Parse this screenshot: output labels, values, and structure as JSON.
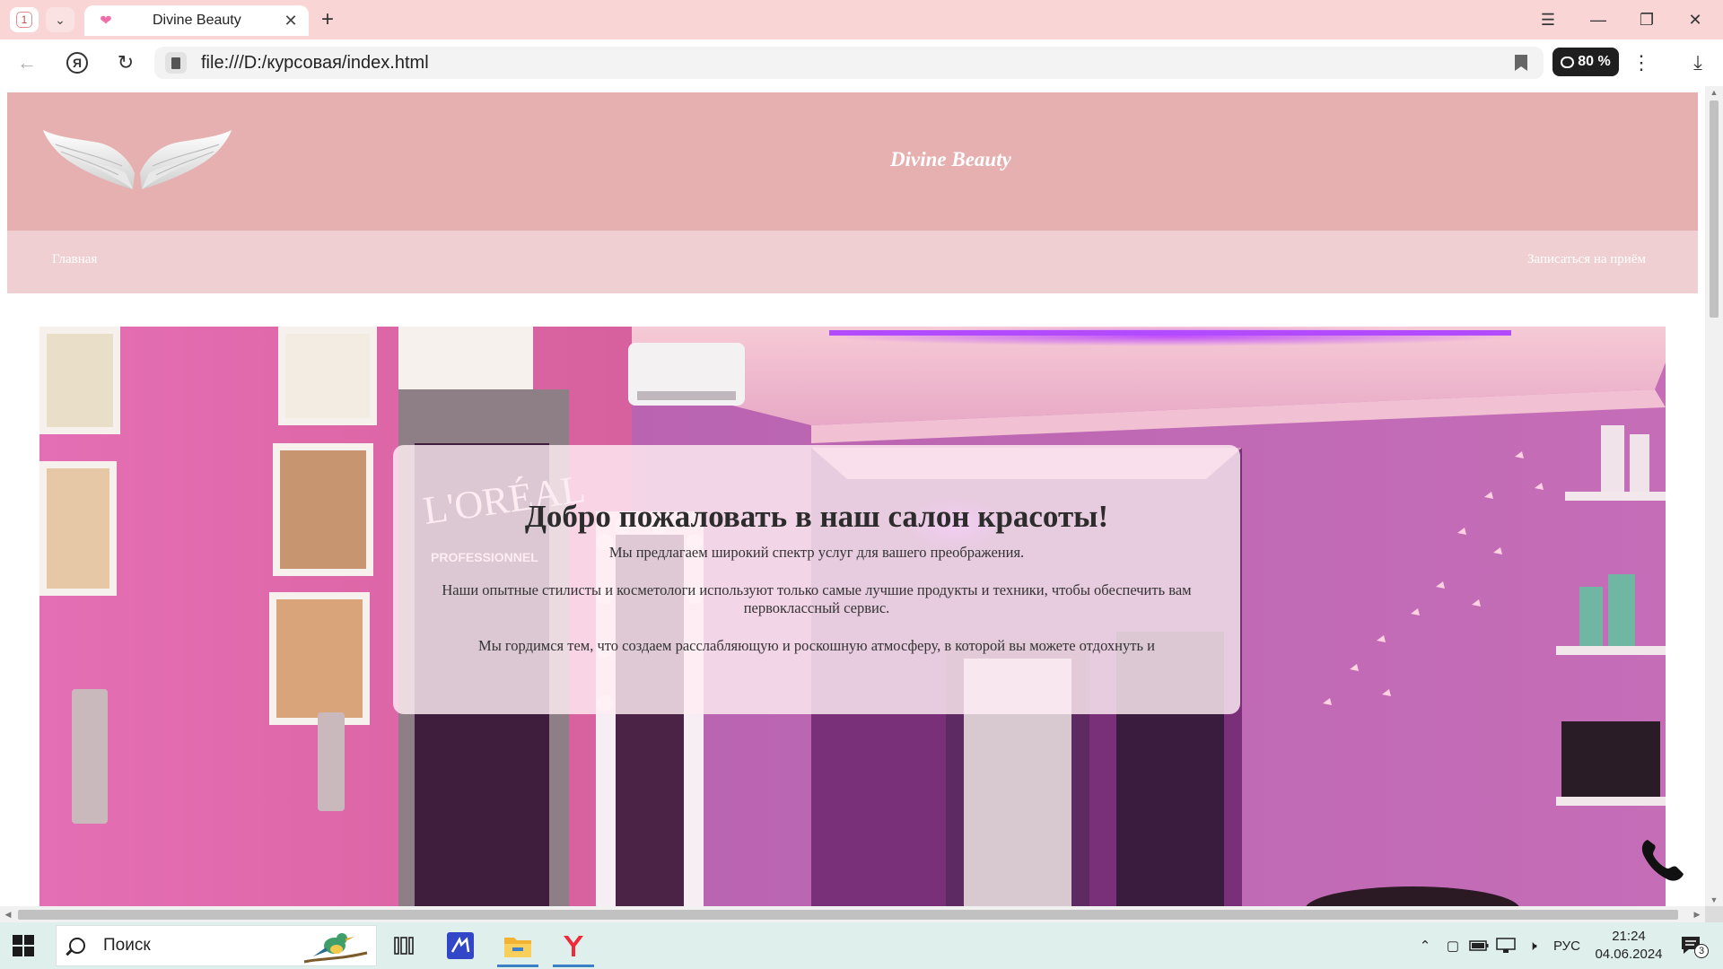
{
  "browser": {
    "tab_count": "1",
    "tab_title": "Divine Beauty",
    "address": "file:///D:/курсовая/index.html",
    "zoom": "80 %"
  },
  "site": {
    "name": "Divine Beauty",
    "nav": {
      "home": "Главная",
      "booking": "Записаться на приём"
    },
    "welcome": {
      "heading": "Добро пожаловать в наш салон красоты!",
      "p1": "Мы предлагаем широкий спектр услуг для вашего преображения.",
      "p2": "Наши опытные стилисты и косметологи используют только самые лучшие продукты и техники, чтобы обеспечить вам первоклассный сервис.",
      "p3": "Мы гордимся тем, что создаем расслабляющую и роскошную атмосферу, в которой вы можете отдохнуть и"
    }
  },
  "taskbar": {
    "search_label": "Поиск",
    "language": "РУС",
    "time": "21:24",
    "date": "04.06.2024",
    "notifications": "3"
  },
  "colors": {
    "browser_chrome": "#f9d5d5",
    "header_bg": "#e6b0b0",
    "nav_bg": "#efcfd1",
    "taskbar_bg": "#dff0ec"
  }
}
